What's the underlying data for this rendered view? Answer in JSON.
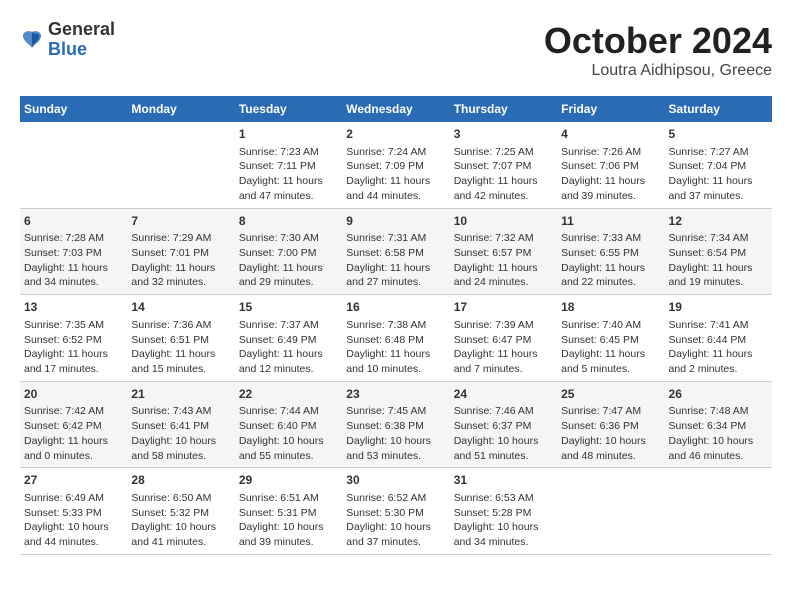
{
  "header": {
    "logo_general": "General",
    "logo_blue": "Blue",
    "title": "October 2024",
    "subtitle": "Loutra Aidhipsou, Greece"
  },
  "days_of_week": [
    "Sunday",
    "Monday",
    "Tuesday",
    "Wednesday",
    "Thursday",
    "Friday",
    "Saturday"
  ],
  "weeks": [
    [
      {
        "day": "",
        "info": ""
      },
      {
        "day": "",
        "info": ""
      },
      {
        "day": "1",
        "info": "Sunrise: 7:23 AM\nSunset: 7:11 PM\nDaylight: 11 hours and 47 minutes."
      },
      {
        "day": "2",
        "info": "Sunrise: 7:24 AM\nSunset: 7:09 PM\nDaylight: 11 hours and 44 minutes."
      },
      {
        "day": "3",
        "info": "Sunrise: 7:25 AM\nSunset: 7:07 PM\nDaylight: 11 hours and 42 minutes."
      },
      {
        "day": "4",
        "info": "Sunrise: 7:26 AM\nSunset: 7:06 PM\nDaylight: 11 hours and 39 minutes."
      },
      {
        "day": "5",
        "info": "Sunrise: 7:27 AM\nSunset: 7:04 PM\nDaylight: 11 hours and 37 minutes."
      }
    ],
    [
      {
        "day": "6",
        "info": "Sunrise: 7:28 AM\nSunset: 7:03 PM\nDaylight: 11 hours and 34 minutes."
      },
      {
        "day": "7",
        "info": "Sunrise: 7:29 AM\nSunset: 7:01 PM\nDaylight: 11 hours and 32 minutes."
      },
      {
        "day": "8",
        "info": "Sunrise: 7:30 AM\nSunset: 7:00 PM\nDaylight: 11 hours and 29 minutes."
      },
      {
        "day": "9",
        "info": "Sunrise: 7:31 AM\nSunset: 6:58 PM\nDaylight: 11 hours and 27 minutes."
      },
      {
        "day": "10",
        "info": "Sunrise: 7:32 AM\nSunset: 6:57 PM\nDaylight: 11 hours and 24 minutes."
      },
      {
        "day": "11",
        "info": "Sunrise: 7:33 AM\nSunset: 6:55 PM\nDaylight: 11 hours and 22 minutes."
      },
      {
        "day": "12",
        "info": "Sunrise: 7:34 AM\nSunset: 6:54 PM\nDaylight: 11 hours and 19 minutes."
      }
    ],
    [
      {
        "day": "13",
        "info": "Sunrise: 7:35 AM\nSunset: 6:52 PM\nDaylight: 11 hours and 17 minutes."
      },
      {
        "day": "14",
        "info": "Sunrise: 7:36 AM\nSunset: 6:51 PM\nDaylight: 11 hours and 15 minutes."
      },
      {
        "day": "15",
        "info": "Sunrise: 7:37 AM\nSunset: 6:49 PM\nDaylight: 11 hours and 12 minutes."
      },
      {
        "day": "16",
        "info": "Sunrise: 7:38 AM\nSunset: 6:48 PM\nDaylight: 11 hours and 10 minutes."
      },
      {
        "day": "17",
        "info": "Sunrise: 7:39 AM\nSunset: 6:47 PM\nDaylight: 11 hours and 7 minutes."
      },
      {
        "day": "18",
        "info": "Sunrise: 7:40 AM\nSunset: 6:45 PM\nDaylight: 11 hours and 5 minutes."
      },
      {
        "day": "19",
        "info": "Sunrise: 7:41 AM\nSunset: 6:44 PM\nDaylight: 11 hours and 2 minutes."
      }
    ],
    [
      {
        "day": "20",
        "info": "Sunrise: 7:42 AM\nSunset: 6:42 PM\nDaylight: 11 hours and 0 minutes."
      },
      {
        "day": "21",
        "info": "Sunrise: 7:43 AM\nSunset: 6:41 PM\nDaylight: 10 hours and 58 minutes."
      },
      {
        "day": "22",
        "info": "Sunrise: 7:44 AM\nSunset: 6:40 PM\nDaylight: 10 hours and 55 minutes."
      },
      {
        "day": "23",
        "info": "Sunrise: 7:45 AM\nSunset: 6:38 PM\nDaylight: 10 hours and 53 minutes."
      },
      {
        "day": "24",
        "info": "Sunrise: 7:46 AM\nSunset: 6:37 PM\nDaylight: 10 hours and 51 minutes."
      },
      {
        "day": "25",
        "info": "Sunrise: 7:47 AM\nSunset: 6:36 PM\nDaylight: 10 hours and 48 minutes."
      },
      {
        "day": "26",
        "info": "Sunrise: 7:48 AM\nSunset: 6:34 PM\nDaylight: 10 hours and 46 minutes."
      }
    ],
    [
      {
        "day": "27",
        "info": "Sunrise: 6:49 AM\nSunset: 5:33 PM\nDaylight: 10 hours and 44 minutes."
      },
      {
        "day": "28",
        "info": "Sunrise: 6:50 AM\nSunset: 5:32 PM\nDaylight: 10 hours and 41 minutes."
      },
      {
        "day": "29",
        "info": "Sunrise: 6:51 AM\nSunset: 5:31 PM\nDaylight: 10 hours and 39 minutes."
      },
      {
        "day": "30",
        "info": "Sunrise: 6:52 AM\nSunset: 5:30 PM\nDaylight: 10 hours and 37 minutes."
      },
      {
        "day": "31",
        "info": "Sunrise: 6:53 AM\nSunset: 5:28 PM\nDaylight: 10 hours and 34 minutes."
      },
      {
        "day": "",
        "info": ""
      },
      {
        "day": "",
        "info": ""
      }
    ]
  ]
}
